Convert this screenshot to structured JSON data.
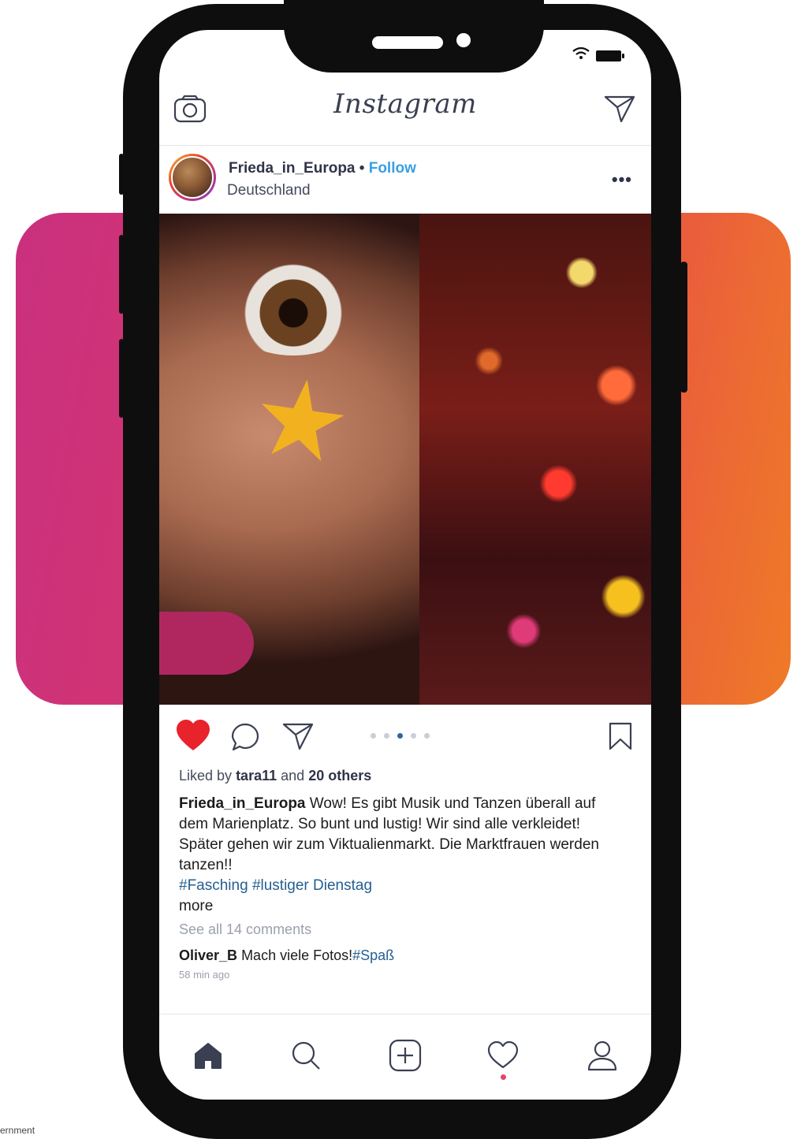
{
  "app": {
    "name": "Instagram"
  },
  "post": {
    "username": "Frieda_in_Europa",
    "separator": "•",
    "follow_label": "Follow",
    "location": "Deutschland",
    "more_label": "•••",
    "carousel": {
      "count": 5,
      "active_index": 2
    },
    "liked_prefix": "Liked by",
    "liked_user": "tara11",
    "liked_and": "and",
    "liked_others": "20 others",
    "caption_user": "Frieda_in_Europa",
    "caption_text": "Wow! Es gibt Musik und Tanzen überall auf dem Marienplatz. So bunt und lustig! Wir sind alle verkleidet! Später gehen wir zum Viktualienmarkt. Die Marktfrauen werden tanzen!!",
    "hashtags": "#Fasching #lustiger Dienstag",
    "more_text": "more",
    "see_all_comments": "See all 14 comments",
    "comment": {
      "user": "Oliver_B",
      "text": "Mach viele Fotos!",
      "hashtag": "#Spaß"
    },
    "time_ago": "58 min ago"
  },
  "footer_fragment": "ernment",
  "icons": {
    "camera": "camera-icon",
    "direct": "paper-plane-icon",
    "like": "heart-icon",
    "comment": "comment-bubble-icon",
    "share": "paper-plane-icon",
    "save": "bookmark-icon",
    "home": "home-icon",
    "search": "search-icon",
    "add": "add-post-icon",
    "activity": "heart-outline-icon",
    "profile": "profile-icon"
  },
  "colors": {
    "like_active": "#e8232c",
    "follow": "#3aa0e0",
    "hashtag": "#245f92",
    "gradient_start": "#c9307f",
    "gradient_end": "#ef7a28",
    "notification_dot": "#e8436b"
  }
}
